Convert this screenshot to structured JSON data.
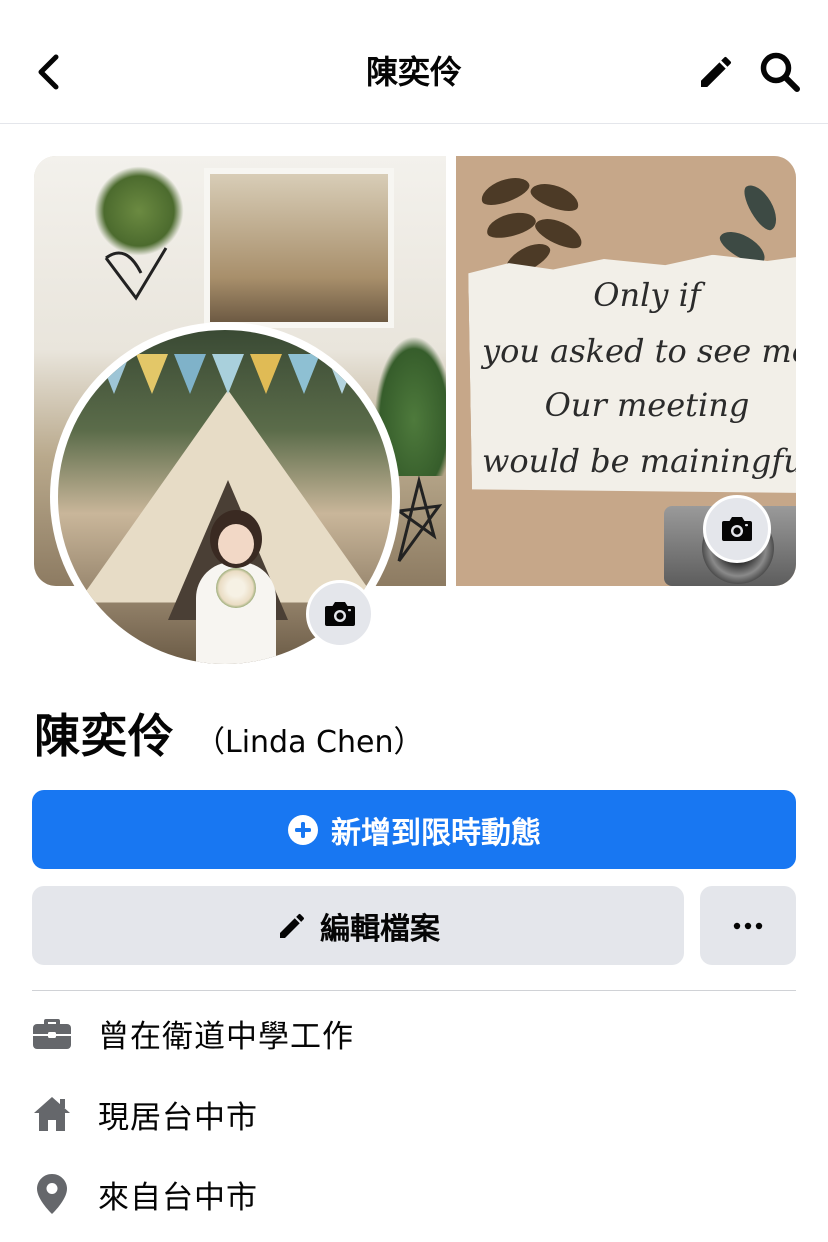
{
  "header": {
    "title": "陳奕伶",
    "back_icon": "chevron-left-icon",
    "edit_icon": "pencil-icon",
    "search_icon": "search-icon"
  },
  "cover": {
    "quote_lines": [
      "Only if",
      "you asked to see me,",
      "Our meeting",
      "would be mainingful"
    ],
    "camera_icon": "camera-icon"
  },
  "profile": {
    "name": "陳奕伶",
    "alt_name": "（Linda Chen）",
    "avatar_camera_icon": "camera-icon"
  },
  "actions": {
    "add_story_label": "新增到限時動態",
    "edit_profile_label": "編輯檔案",
    "more_icon": "more-icon"
  },
  "details": [
    {
      "icon": "briefcase-icon",
      "text": "曾在衛道中學工作"
    },
    {
      "icon": "home-icon",
      "text": "現居台中市"
    },
    {
      "icon": "location-pin-icon",
      "text": "來自台中市"
    }
  ],
  "colors": {
    "primary": "#1877f2",
    "secondary_button": "#e4e6eb",
    "text": "#050505",
    "icon_gray": "#65676b"
  }
}
